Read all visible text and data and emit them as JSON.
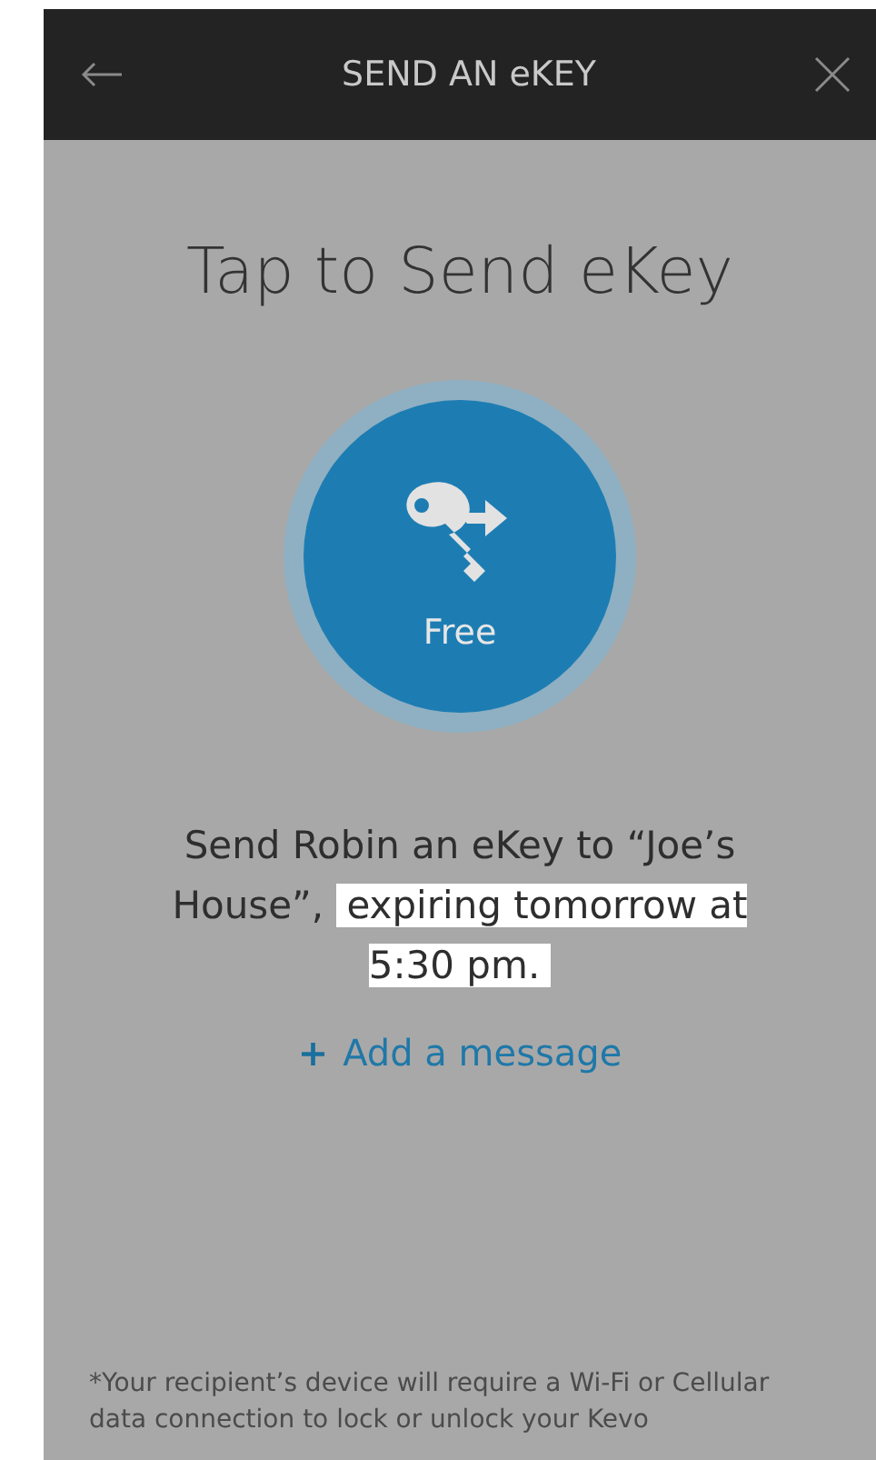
{
  "header": {
    "title": "SEND AN eKEY"
  },
  "heading": "Tap to Send eKey",
  "send_button": {
    "label": "Free"
  },
  "message": {
    "text": "Send Robin an eKey to “Joe’s House”,",
    "highlight": "expiring tomorrow at 5:30 pm."
  },
  "add_message": {
    "icon": "+",
    "label": "Add a message"
  },
  "footnote": "*Your recipient’s device will require a Wi-Fi or Cellular data connection to lock or unlock your Kevo"
}
